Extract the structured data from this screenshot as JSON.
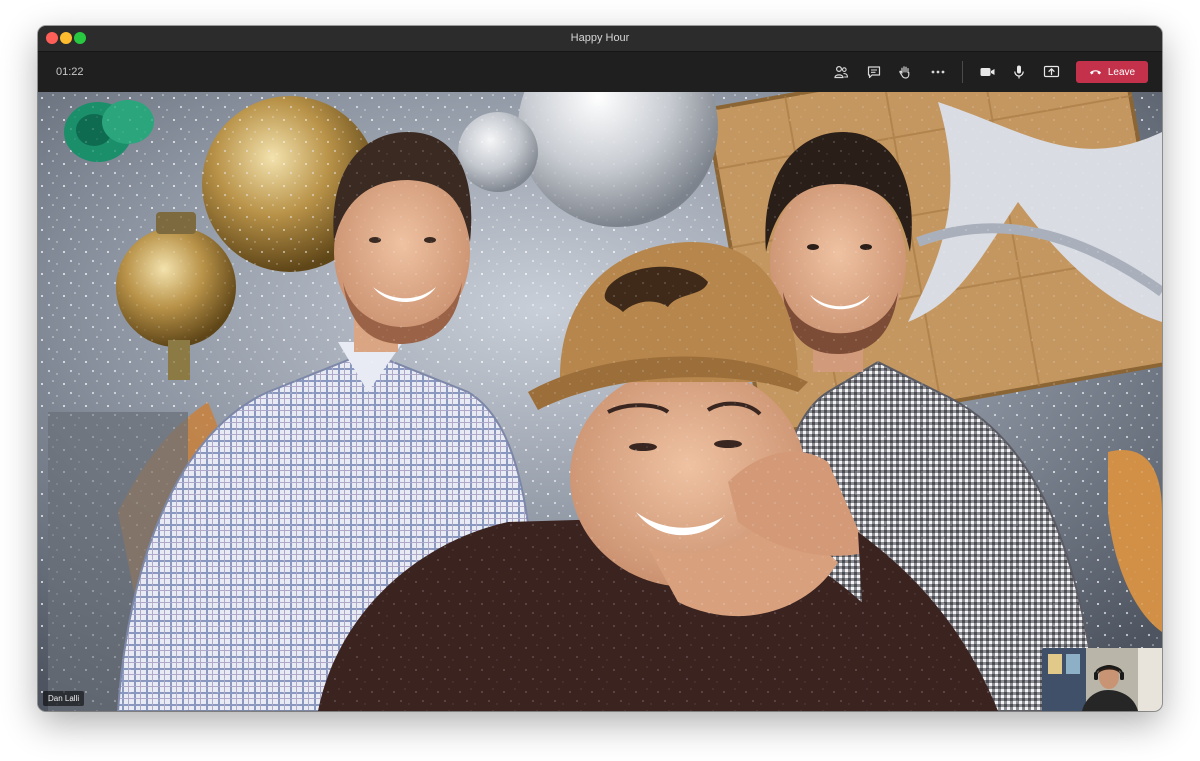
{
  "window": {
    "title": "Happy Hour"
  },
  "toolbar": {
    "timer": "01:22",
    "leave_label": "Leave",
    "leave_color": "#c4314b",
    "icons": [
      "participants-icon",
      "chat-icon",
      "raise-hand-icon",
      "more-options-icon",
      "camera-icon",
      "microphone-icon",
      "share-screen-icon",
      "hang-up-icon"
    ]
  },
  "video": {
    "participant_name": "Dan Lalli"
  },
  "colors": {
    "titlebar": "#2c2c2c",
    "toolbar": "#1f1f1f",
    "close": "#ff5f57",
    "minimize": "#febc2e",
    "maximize": "#28c840"
  }
}
